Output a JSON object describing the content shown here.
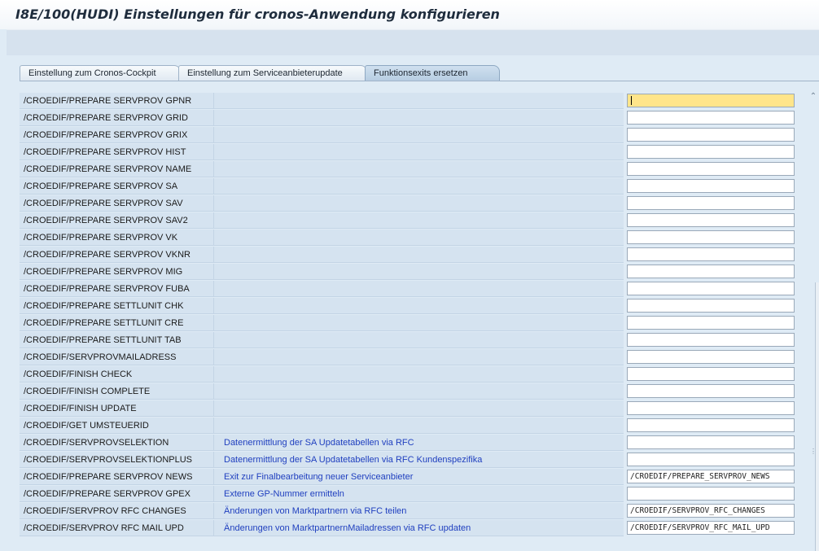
{
  "window": {
    "title": "I8E/100(HUDI) Einstellungen für cronos-Anwendung konfigurieren"
  },
  "tabs": [
    {
      "label": "Einstellung zum Cronos-Cockpit",
      "active": false
    },
    {
      "label": "Einstellung zum Serviceanbieterupdate",
      "active": false
    },
    {
      "label": "Funktionsexits ersetzen",
      "active": true
    }
  ],
  "rows": [
    {
      "name": "/CROEDIF/PREPARE SERVPROV GPNR",
      "description": "",
      "value": "",
      "focused": true
    },
    {
      "name": "/CROEDIF/PREPARE SERVPROV GRID",
      "description": "",
      "value": ""
    },
    {
      "name": "/CROEDIF/PREPARE SERVPROV GRIX",
      "description": "",
      "value": ""
    },
    {
      "name": "/CROEDIF/PREPARE SERVPROV HIST",
      "description": "",
      "value": ""
    },
    {
      "name": "/CROEDIF/PREPARE SERVPROV NAME",
      "description": "",
      "value": ""
    },
    {
      "name": "/CROEDIF/PREPARE SERVPROV SA",
      "description": "",
      "value": ""
    },
    {
      "name": "/CROEDIF/PREPARE SERVPROV SAV",
      "description": "",
      "value": ""
    },
    {
      "name": "/CROEDIF/PREPARE SERVPROV SAV2",
      "description": "",
      "value": ""
    },
    {
      "name": "/CROEDIF/PREPARE SERVPROV VK",
      "description": "",
      "value": ""
    },
    {
      "name": "/CROEDIF/PREPARE SERVPROV VKNR",
      "description": "",
      "value": ""
    },
    {
      "name": "/CROEDIF/PREPARE SERVPROV MIG",
      "description": "",
      "value": ""
    },
    {
      "name": "/CROEDIF/PREPARE SERVPROV FUBA",
      "description": "",
      "value": ""
    },
    {
      "name": "/CROEDIF/PREPARE SETTLUNIT CHK",
      "description": "",
      "value": ""
    },
    {
      "name": "/CROEDIF/PREPARE SETTLUNIT CRE",
      "description": "",
      "value": ""
    },
    {
      "name": "/CROEDIF/PREPARE SETTLUNIT TAB",
      "description": "",
      "value": ""
    },
    {
      "name": "/CROEDIF/SERVPROVMAILADRESS",
      "description": "",
      "value": ""
    },
    {
      "name": "/CROEDIF/FINISH CHECK",
      "description": "",
      "value": ""
    },
    {
      "name": "/CROEDIF/FINISH COMPLETE",
      "description": "",
      "value": ""
    },
    {
      "name": "/CROEDIF/FINISH UPDATE",
      "description": "",
      "value": ""
    },
    {
      "name": "/CROEDIF/GET UMSTEUERID",
      "description": "",
      "value": ""
    },
    {
      "name": "/CROEDIF/SERVPROVSELEKTION",
      "description": "Datenermittlung der SA Updatetabellen via RFC",
      "value": ""
    },
    {
      "name": "/CROEDIF/SERVPROVSELEKTIONPLUS",
      "description": "Datenermittlung der SA Updatetabellen via RFC Kundenspezifika",
      "value": ""
    },
    {
      "name": "/CROEDIF/PREPARE SERVPROV NEWS",
      "description": "Exit zur Finalbearbeitung neuer Serviceanbieter",
      "value": "/CROEDIF/PREPARE_SERVPROV_NEWS"
    },
    {
      "name": "/CROEDIF/PREPARE SERVPROV GPEX",
      "description": "Externe GP-Nummer ermitteln",
      "value": ""
    },
    {
      "name": "/CROEDIF/SERVPROV RFC CHANGES",
      "description": "Änderungen von Marktpartnern via RFC teilen",
      "value": "/CROEDIF/SERVPROV_RFC_CHANGES"
    },
    {
      "name": "/CROEDIF/SERVPROV RFC MAIL UPD",
      "description": "Änderungen von MarktpartnernMailadressen via RFC updaten",
      "value": "/CROEDIF/SERVPROV_RFC_MAIL_UPD"
    }
  ],
  "icons": {
    "scroll_up": "chevron-up-icon"
  }
}
